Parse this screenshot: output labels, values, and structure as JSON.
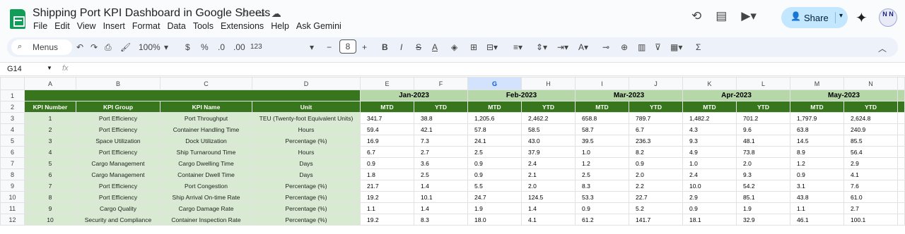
{
  "doc": {
    "title": "Shipping Port KPI Dashboard in Google Sheets",
    "menus": [
      "File",
      "Edit",
      "View",
      "Insert",
      "Format",
      "Data",
      "Tools",
      "Extensions",
      "Help",
      "Ask Gemini"
    ],
    "share_label": "Share",
    "avatar_text": "N N"
  },
  "toolbar": {
    "menus_label": "Menus",
    "zoom": "100%",
    "currency": "$",
    "percent": "%",
    "dec_dec": ".0",
    "inc_dec": ".00",
    "num_format": "123",
    "font_size": "8",
    "minus": "−",
    "plus": "+",
    "bold": "B",
    "italic": "I",
    "strike": "S",
    "text_color": "A",
    "sum": "Σ"
  },
  "formula_bar": {
    "cell_ref": "G14",
    "fx": "fx"
  },
  "columns": [
    "A",
    "B",
    "C",
    "D",
    "E",
    "F",
    "G",
    "H",
    "I",
    "J",
    "K",
    "L",
    "M",
    "N"
  ],
  "selected_column": "G",
  "months": [
    "Jan-2023",
    "Feb-2023",
    "Mar-2023",
    "Apr-2023",
    "May-2023"
  ],
  "headers": {
    "kpi_number": "KPI Number",
    "kpi_group": "KPI Group",
    "kpi_name": "KPI Name",
    "unit": "Unit",
    "mtd": "MTD",
    "ytd": "YTD"
  },
  "row_numbers": [
    "1",
    "2",
    "3",
    "4",
    "5",
    "6",
    "7",
    "8",
    "9",
    "10",
    "11",
    "12"
  ],
  "rows": [
    [
      "1",
      "Port Efficiency",
      "Port Throughput",
      "TEU (Twenty-foot Equivalent Units)",
      "341.7",
      "38.8",
      "1,205.6",
      "2,462.2",
      "658.8",
      "789.7",
      "1,482.2",
      "701.2",
      "1,797.9",
      "2,624.8"
    ],
    [
      "2",
      "Port Efficiency",
      "Container Handling Time",
      "Hours",
      "59.4",
      "42.1",
      "57.8",
      "58.5",
      "58.7",
      "6.7",
      "4.3",
      "9.6",
      "63.8",
      "240.9"
    ],
    [
      "3",
      "Space Utilization",
      "Dock Utilization",
      "Percentage (%)",
      "16.9",
      "7.3",
      "24.1",
      "43.0",
      "39.5",
      "236.3",
      "9.3",
      "48.1",
      "14.5",
      "85.5"
    ],
    [
      "4",
      "Port Efficiency",
      "Ship Turnaround Time",
      "Hours",
      "6.7",
      "2.7",
      "2.5",
      "37.9",
      "1.0",
      "8.2",
      "4.9",
      "73.8",
      "8.9",
      "56.4"
    ],
    [
      "5",
      "Cargo Management",
      "Cargo Dwelling Time",
      "Days",
      "0.9",
      "3.6",
      "0.9",
      "2.4",
      "1.2",
      "0.9",
      "1.0",
      "2.0",
      "1.2",
      "2.9"
    ],
    [
      "6",
      "Cargo Management",
      "Container Dwell Time",
      "Days",
      "1.8",
      "2.5",
      "0.9",
      "2.1",
      "2.5",
      "2.0",
      "2.4",
      "9.3",
      "0.9",
      "4.1"
    ],
    [
      "7",
      "Port Efficiency",
      "Port Congestion",
      "Percentage (%)",
      "21.7",
      "1.4",
      "5.5",
      "2.0",
      "8.3",
      "2.2",
      "10.0",
      "54.2",
      "3.1",
      "7.6"
    ],
    [
      "8",
      "Port Efficiency",
      "Ship Arrival On-time Rate",
      "Percentage (%)",
      "19.2",
      "10.1",
      "24.7",
      "124.5",
      "53.3",
      "22.7",
      "2.9",
      "85.1",
      "43.8",
      "61.0"
    ],
    [
      "9",
      "Cargo Quality",
      "Cargo Damage Rate",
      "Percentage (%)",
      "1.1",
      "1.4",
      "1.9",
      "1.4",
      "0.9",
      "5.2",
      "0.9",
      "1.9",
      "1.1",
      "2.7"
    ],
    [
      "10",
      "Security and Compliance",
      "Container Inspection Rate",
      "Percentage (%)",
      "19.2",
      "8.3",
      "18.0",
      "4.1",
      "61.2",
      "141.7",
      "18.1",
      "32.9",
      "46.1",
      "100.1"
    ]
  ]
}
